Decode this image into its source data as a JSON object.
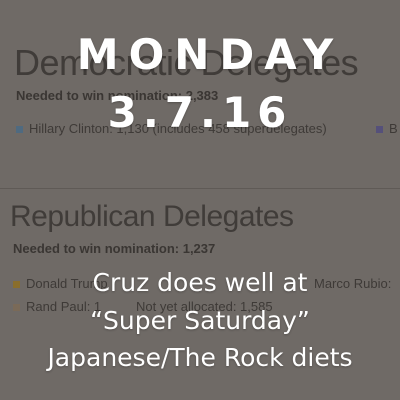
{
  "background": {
    "dem_heading": "Democratic Delegates",
    "dem_needed": "Needed to win nomination: 2,383",
    "dem_legend_clinton": "Hillary Clinton: 1,130 (includes 458 superdelegates)",
    "dem_legend_sanders": "B",
    "rep_heading": "Republican Delegates",
    "rep_needed": "Needed to win nomination: 1,237",
    "rep_legend_trump": "Donald Trump",
    "rep_legend_rubio": "Marco Rubio:",
    "rep_legend_paul": "Rand Paul: 1",
    "rep_legend_unallocated": "Not yet allocated: 1,585",
    "colors": {
      "clinton": "#4f6a80",
      "sanders": "#55507a",
      "trump": "#8a6e2c",
      "paul": "#7a6a58"
    }
  },
  "overlay": {
    "day": "MONDAY",
    "date": "3.7.16",
    "headline_1": "Cruz does well at",
    "headline_2": "“Super Saturday”",
    "headline_3": "Japanese/The Rock diets"
  }
}
